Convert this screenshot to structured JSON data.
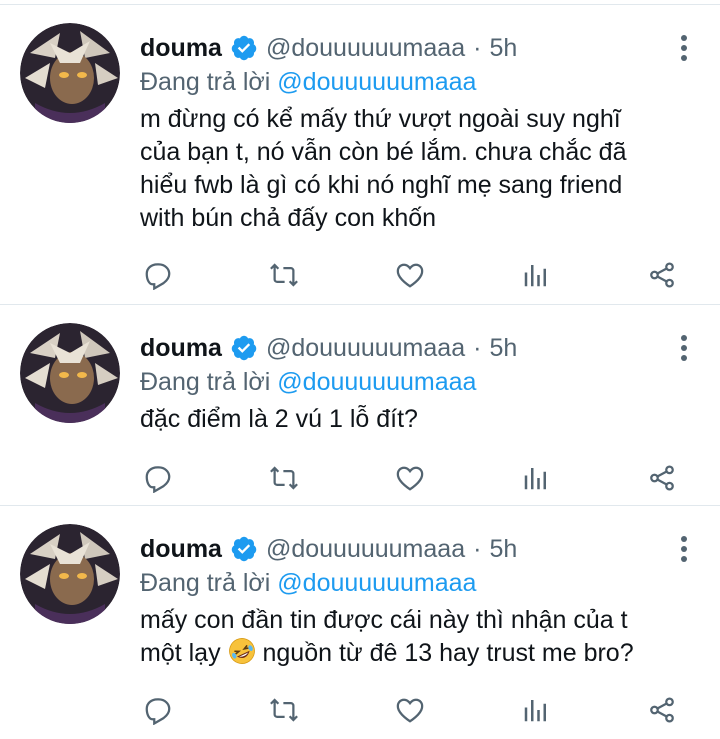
{
  "colors": {
    "accent": "#1d9bf0",
    "muted": "#536471",
    "text": "#0f1419",
    "divider": "#e1e8ed"
  },
  "tweets": [
    {
      "name": "douma",
      "handle": "@douuuuuumaaa",
      "time": "5h",
      "reply_prefix": "Đang trả lời ",
      "reply_to": "@douuuuuumaaa",
      "text": "m đừng có kể mấy thứ vượt ngoài suy nghĩ của bạn t, nó vẫn còn bé lắm. chưa chắc đã hiểu fwb là gì có khi nó nghĩ mẹ sang friend with bún chả đấy con khốn"
    },
    {
      "name": "douma",
      "handle": "@douuuuuumaaa",
      "time": "5h",
      "reply_prefix": "Đang trả lời ",
      "reply_to": "@douuuuuumaaa",
      "text": "đặc điểm là 2 vú 1 lỗ đít?"
    },
    {
      "name": "douma",
      "handle": "@douuuuuumaaa",
      "time": "5h",
      "reply_prefix": "Đang trả lời ",
      "reply_to": "@douuuuuumaaa",
      "text_before_emoji": "mấy con đần tin được cái này thì nhận của t một lạy ",
      "emoji": "rolling-on-floor-laughing",
      "text_after_emoji": " nguồn từ đê 13 hay trust me bro?"
    }
  ],
  "icons": [
    "reply-icon",
    "retweet-icon",
    "like-icon",
    "analytics-icon",
    "share-icon",
    "more-icon",
    "verified-icon"
  ]
}
